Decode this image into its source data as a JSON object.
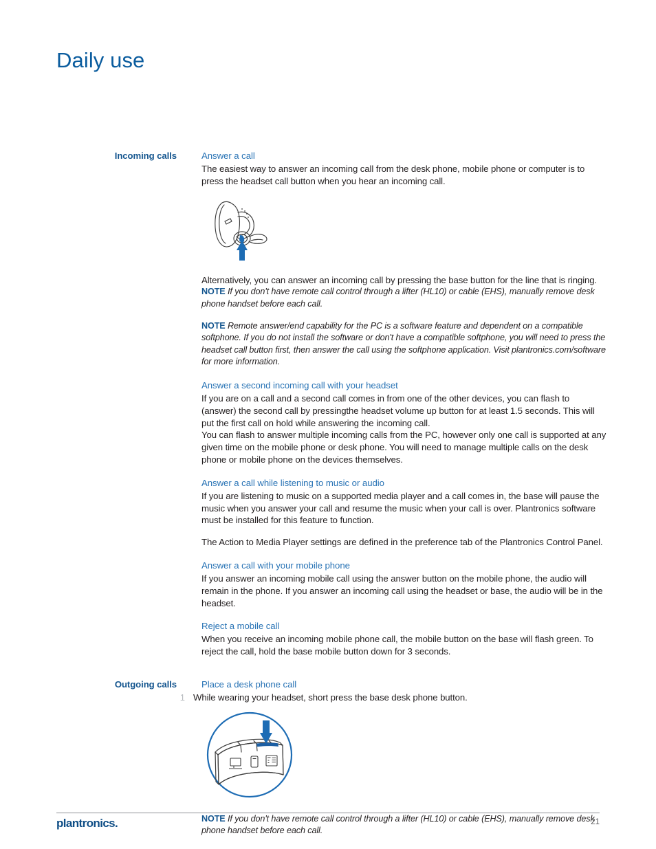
{
  "document": {
    "title": "Daily use",
    "page_number": "21",
    "brand": "plantronics",
    "brand_mark": "."
  },
  "sections": [
    {
      "sidebar_label": "Incoming calls",
      "blocks": [
        {
          "kind": "subheading",
          "text": "Answer a call"
        },
        {
          "kind": "paragraph",
          "text": "The easiest way to answer an incoming call from the desk phone, mobile phone or computer is to press the headset call button when you hear an incoming call."
        },
        {
          "kind": "figure",
          "name": "headset-call-button-illustration",
          "alt": "Headset with blue arrow pointing up at the call button"
        },
        {
          "kind": "paragraph",
          "text": "Alternatively, you can answer an incoming call by pressing the base button for the line that is ringing."
        },
        {
          "kind": "note",
          "tag": "NOTE",
          "text": "If you don't have remote call control through a lifter (HL10) or cable (EHS), manually remove desk phone handset before each call."
        },
        {
          "kind": "note",
          "tag": "NOTE",
          "text": "Remote answer/end capability for the PC is a software feature and dependent on a compatible softphone. If you do not install the software or don't have a compatible softphone, you will need to press the headset call button first, then answer the call using the softphone application. Visit plantronics.com/software for more information."
        },
        {
          "kind": "subheading",
          "text": "Answer a second incoming call with your headset"
        },
        {
          "kind": "paragraph",
          "text": "If you are on a call and a second call comes in from one of the other devices, you can flash to (answer) the second call by pressingthe headset volume up button for at least 1.5 seconds. This will put the first call on hold while answering the incoming call."
        },
        {
          "kind": "paragraph",
          "text": "You can flash to answer multiple incoming calls from the PC, however only one call is supported at any given time on the mobile phone or desk phone. You will need to manage multiple calls on the desk phone or mobile phone on the devices themselves."
        },
        {
          "kind": "subheading",
          "text": "Answer a call while listening to music or audio"
        },
        {
          "kind": "paragraph",
          "text": "If you are listening to music on a supported media player and a call comes in, the base will pause the music when you answer your call and resume the music when your call is over. Plantronics software must be installed for this feature to function."
        },
        {
          "kind": "paragraph",
          "text": "The Action to Media Player settings are defined in the preference tab of the Plantronics Control Panel."
        },
        {
          "kind": "subheading",
          "text": "Answer a call with your mobile phone"
        },
        {
          "kind": "paragraph",
          "text": "If you answer an incoming mobile call using the answer button on the mobile phone, the audio will remain in the phone. If you answer an incoming call using the headset or base, the audio will be in the headset."
        },
        {
          "kind": "subheading",
          "text": "Reject a mobile call"
        },
        {
          "kind": "paragraph",
          "text": "When you receive an incoming mobile phone call, the mobile button on the base will flash green. To reject the call, hold the base mobile button down for 3 seconds."
        }
      ]
    },
    {
      "sidebar_label": "Outgoing calls",
      "blocks": [
        {
          "kind": "subheading",
          "text": "Place a desk phone call"
        },
        {
          "kind": "step",
          "number": "1",
          "text": "While wearing your headset, short press the base desk phone button."
        },
        {
          "kind": "figure",
          "name": "base-desk-phone-button-illustration",
          "alt": "Base station in a circle with blue arrow pointing down at the desk phone button"
        },
        {
          "kind": "note",
          "tag": "NOTE",
          "text": "If you don't have remote call control through a lifter (HL10) or cable (EHS), manually remove desk phone handset before each call."
        }
      ]
    }
  ],
  "colors": {
    "title_blue": "#0a5c9e",
    "sidebar_blue": "#15568f",
    "subheading_blue": "#2873b5",
    "body_text": "#231f20",
    "arrow_blue": "#1d6cb4",
    "step_number_gray": "#b8bcbf",
    "rule_gray": "#8d9094"
  },
  "figures": {
    "headset": {
      "name": "headset-illustration",
      "arrow_direction": "up"
    },
    "base": {
      "name": "base-station-illustration",
      "arrow_direction": "down",
      "buttons": [
        "computer-icon",
        "mobile-phone-icon",
        "desk-phone-icon"
      ]
    }
  }
}
